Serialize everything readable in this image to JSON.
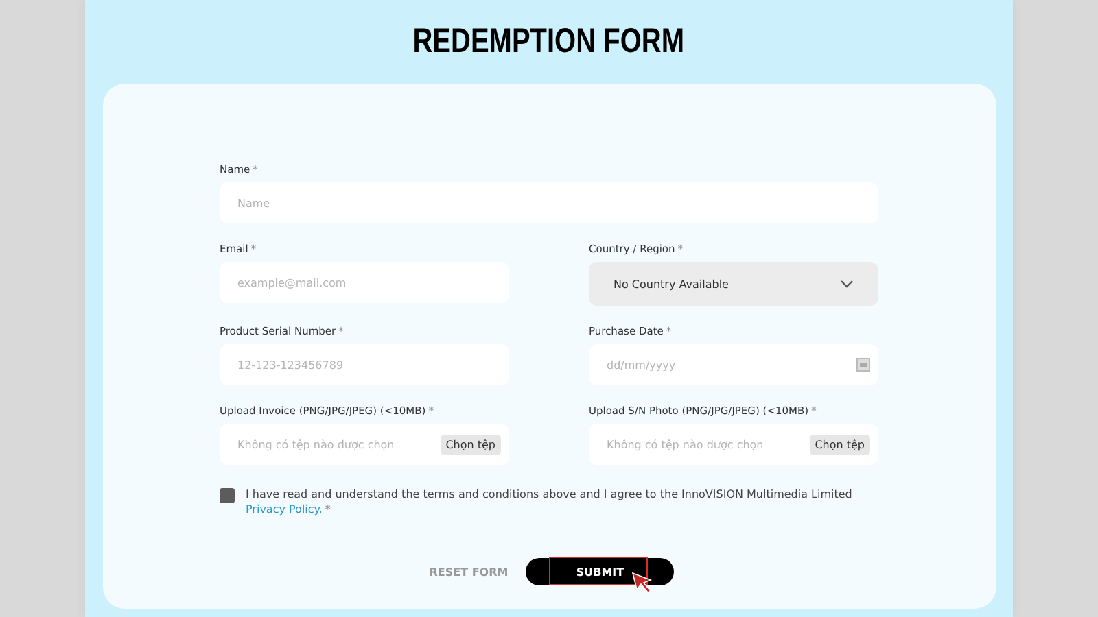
{
  "title": "REDEMPTION FORM",
  "fields": [
    {
      "kind": "text",
      "label": "Name",
      "mark": "*",
      "placeholder": "Name",
      "wide": true
    },
    {
      "kind": "text",
      "label": "Email",
      "mark": "*",
      "placeholder": "example@mail.com",
      "wide": false
    },
    {
      "kind": "select",
      "label": "Country / Region",
      "mark": "*",
      "value": "No Country Available",
      "wide": false
    },
    {
      "kind": "text",
      "label": "Product Serial Number",
      "mark": "*",
      "placeholder": "12-123-123456789",
      "wide": false
    },
    {
      "kind": "date",
      "label": "Purchase Date",
      "mark": "*",
      "placeholder": "dd/mm/yyyy",
      "wide": false
    },
    {
      "kind": "file",
      "label": "Upload Invoice (PNG/JPG/JPEG) (<10MB)",
      "mark": "*",
      "status": "Không có tệp nào được chọn",
      "button": "Chọn tệp",
      "wide": false
    },
    {
      "kind": "file",
      "label": "Upload S/N Photo (PNG/JPG/JPEG) (<10MB)",
      "mark": "*",
      "status": "Không có tệp nào được chọn",
      "button": "Chọn tệp",
      "wide": false
    }
  ],
  "terms": {
    "checked": false,
    "text": "I have read and understand the terms and conditions above and I agree to the InnoVISION Multimedia Limited ",
    "link": "Privacy Policy.",
    "mark": "*"
  },
  "buttons": [
    {
      "kind": "reset",
      "label": "RESET FORM"
    },
    {
      "kind": "submit",
      "label": "SUBMIT",
      "highlighted": true
    }
  ]
}
